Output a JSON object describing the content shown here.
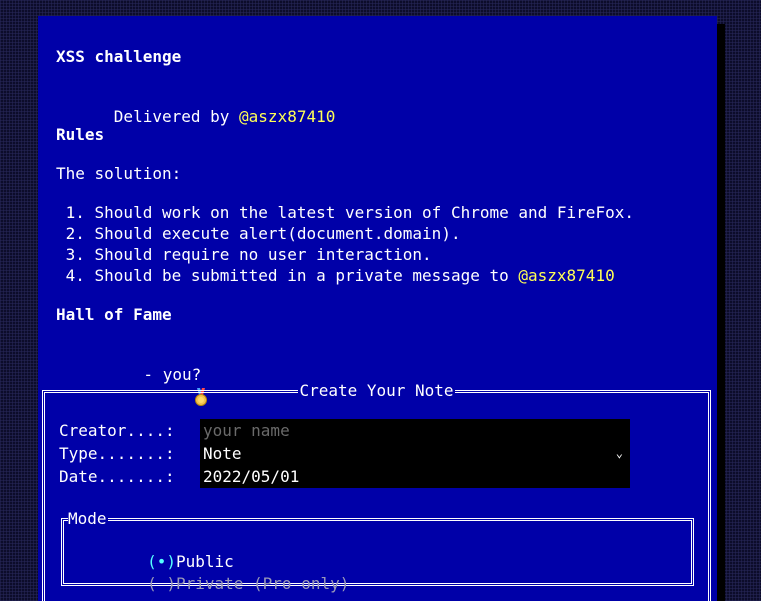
{
  "title": "XSS challenge",
  "delivered_by": {
    "prefix": "Delivered by ",
    "handle": "@aszx87410"
  },
  "rules_heading": "Rules",
  "solution_intro": "The solution:",
  "rules": [
    {
      "num": " 1. ",
      "text": "Should work on the latest version of Chrome and FireFox."
    },
    {
      "num": " 2. ",
      "text": "Should execute alert(document.domain)."
    },
    {
      "num": " 3. ",
      "text": "Should require no user interaction."
    },
    {
      "num": " 4. ",
      "text": "Should be submitted in a private message to ",
      "handle": "@aszx87410"
    }
  ],
  "hall_of_fame": {
    "heading": "Hall of Fame",
    "entry_text": " - you?",
    "icon": "medal-icon"
  },
  "note_form": {
    "title": "Create Your Note",
    "creator_label": "Creator....: ",
    "creator_value": "",
    "creator_placeholder": "your name",
    "type_label": "Type.......: ",
    "type_value": "Note",
    "date_label": "Date.......: ",
    "date_value": "2022/05/01",
    "mode": {
      "title": "Mode",
      "options": [
        {
          "marker": "(•)",
          "label": "Public",
          "selected": true
        },
        {
          "marker": "( )",
          "label": "Private (Pro only)",
          "selected": false
        }
      ]
    }
  },
  "colors": {
    "panel_bg": "#0000a8",
    "handle": "#ffff55",
    "selected_radio": "#55ffff",
    "disabled_text": "#9a9ab8",
    "field_bg": "#000000"
  }
}
